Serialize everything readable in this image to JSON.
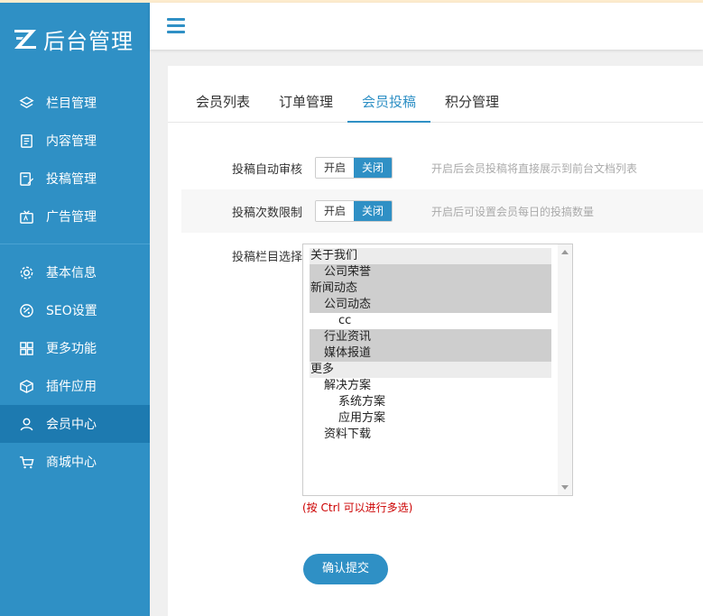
{
  "brand": {
    "logo_text": "后台管理"
  },
  "sidebar": {
    "group1": [
      {
        "label": "栏目管理",
        "icon": "layers-icon"
      },
      {
        "label": "内容管理",
        "icon": "document-icon"
      },
      {
        "label": "投稿管理",
        "icon": "edit-document-icon"
      },
      {
        "label": "广告管理",
        "icon": "ad-icon"
      }
    ],
    "group2": [
      {
        "label": "基本信息",
        "icon": "gear-icon"
      },
      {
        "label": "SEO设置",
        "icon": "seo-icon"
      },
      {
        "label": "更多功能",
        "icon": "grid-icon"
      },
      {
        "label": "插件应用",
        "icon": "cube-icon"
      },
      {
        "label": "会员中心",
        "icon": "user-icon",
        "active": true
      },
      {
        "label": "商城中心",
        "icon": "cart-icon"
      }
    ]
  },
  "tabs": [
    {
      "label": "会员列表"
    },
    {
      "label": "订单管理"
    },
    {
      "label": "会员投稿",
      "active": true
    },
    {
      "label": "积分管理"
    }
  ],
  "form": {
    "auto_review": {
      "label": "投稿自动审核",
      "on_label": "开启",
      "off_label": "关闭",
      "selected": "关闭",
      "hint": "开启后会员投稿将直接展示到前台文档列表"
    },
    "limit": {
      "label": "投稿次数限制",
      "on_label": "开启",
      "off_label": "关闭",
      "selected": "关闭",
      "hint": "开启后可设置会员每日的投搞数量"
    },
    "columns": {
      "label": "投稿栏目选择",
      "options": [
        {
          "text": "关于我们",
          "level": 0,
          "state": "light"
        },
        {
          "text": "公司荣誉",
          "level": 1,
          "state": "selected"
        },
        {
          "text": "新闻动态",
          "level": 0,
          "state": "selected"
        },
        {
          "text": "公司动态",
          "level": 1,
          "state": "selected"
        },
        {
          "text": "cc",
          "level": 2,
          "state": "none"
        },
        {
          "text": "行业资讯",
          "level": 1,
          "state": "selected"
        },
        {
          "text": "媒体报道",
          "level": 1,
          "state": "selected"
        },
        {
          "text": "更多",
          "level": 0,
          "state": "light"
        },
        {
          "text": "解决方案",
          "level": 1,
          "state": "none"
        },
        {
          "text": "系统方案",
          "level": 2,
          "state": "none"
        },
        {
          "text": "应用方案",
          "level": 2,
          "state": "none"
        },
        {
          "text": "资料下载",
          "level": 1,
          "state": "none"
        }
      ],
      "note": "(按 Ctrl 可以进行多选)"
    },
    "submit_label": "确认提交"
  },
  "colors": {
    "accent": "#2f90c5",
    "sidebar_bg": "#2f90c5",
    "active_nav": "#1d7ab0",
    "note_red": "#cc0000"
  }
}
